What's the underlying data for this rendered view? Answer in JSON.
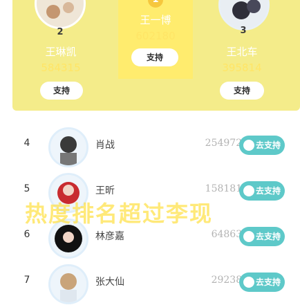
{
  "podium": {
    "first": {
      "rank": "1",
      "name": "王一博",
      "votes": "602180",
      "support_label": "支持"
    },
    "second": {
      "rank": "2",
      "name": "王琳凯",
      "votes": "584315",
      "support_label": "支持"
    },
    "third": {
      "rank": "3",
      "name": "王北车",
      "votes": "395814",
      "support_label": "支持"
    }
  },
  "list": [
    {
      "rank": "4",
      "name": "肖战",
      "votes": "254972",
      "button_label": "去支持"
    },
    {
      "rank": "5",
      "name": "王昕",
      "votes": "158181",
      "button_label": "去支持"
    },
    {
      "rank": "6",
      "name": "林彦嘉",
      "votes": "64863",
      "button_label": "去支持"
    },
    {
      "rank": "7",
      "name": "张大仙",
      "votes": "29238",
      "button_label": "去支持"
    }
  ],
  "side_numbers": [
    "4",
    "5",
    "6",
    "7"
  ],
  "watermark": "热度排名超过李现",
  "colors": {
    "podium_bg": "#f4ec8a",
    "accent_button": "#5ec9c9",
    "votes_gold": "#ffe566"
  }
}
